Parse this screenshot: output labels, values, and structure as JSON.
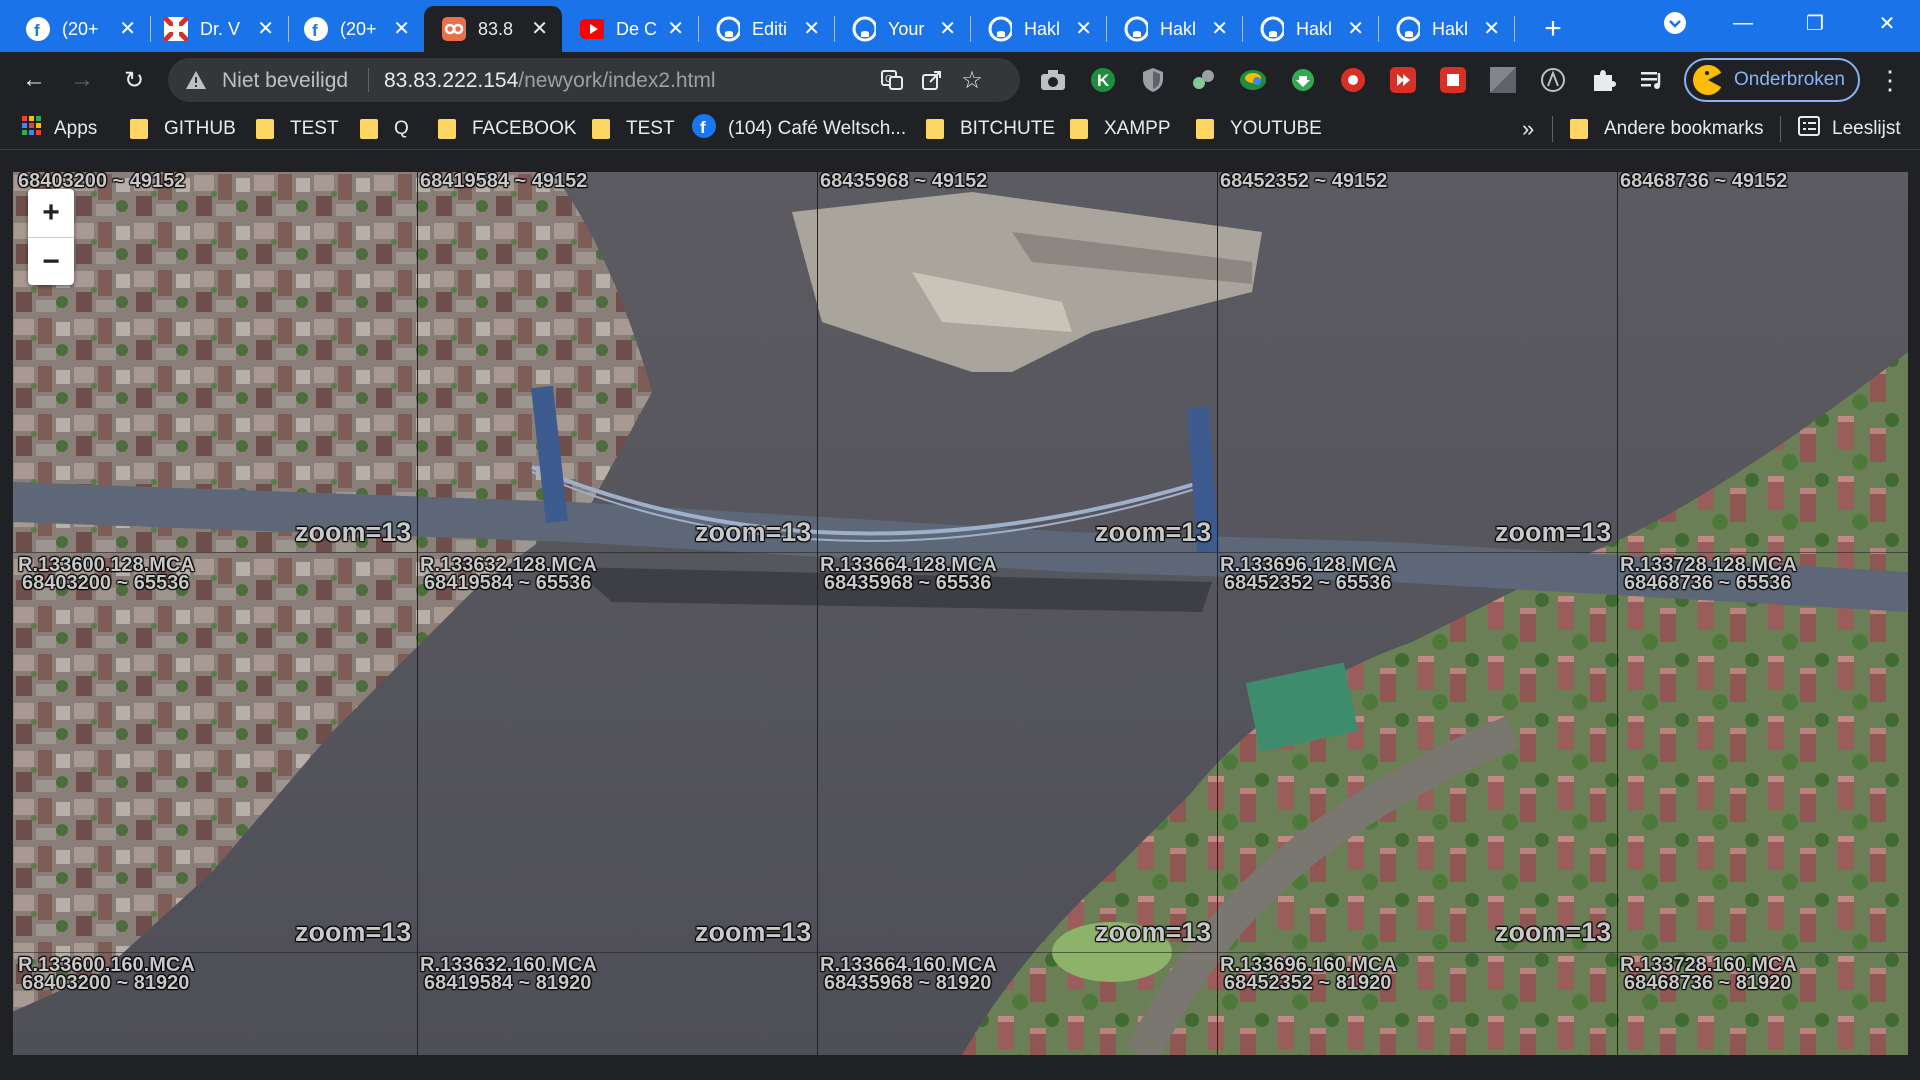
{
  "tabs": [
    {
      "title": "(20+",
      "icon": "facebook-icon"
    },
    {
      "title": "Dr. V",
      "icon": "flag-icon"
    },
    {
      "title": "(20+",
      "icon": "facebook-icon"
    },
    {
      "title": "83.8",
      "icon": "mca-icon",
      "active": true
    },
    {
      "title": "De C",
      "icon": "youtube-icon"
    },
    {
      "title": "Editi",
      "icon": "github-icon"
    },
    {
      "title": "Your",
      "icon": "github-icon"
    },
    {
      "title": "Hakl",
      "icon": "github-icon"
    },
    {
      "title": "Hakl",
      "icon": "github-icon"
    },
    {
      "title": "Hakl",
      "icon": "github-icon"
    },
    {
      "title": "Hakl",
      "icon": "github-icon"
    }
  ],
  "omnibox": {
    "security": "Niet beveiligd",
    "host": "83.83.222.154",
    "path": "/newyork/index2.html"
  },
  "profile": {
    "label": "Onderbroken"
  },
  "bookmarks": [
    {
      "label": "Apps",
      "icon": "apps-grid-icon"
    },
    {
      "label": "GITHUB",
      "icon": "folder-icon"
    },
    {
      "label": "TEST",
      "icon": "folder-icon"
    },
    {
      "label": "Q",
      "icon": "folder-icon"
    },
    {
      "label": "FACEBOOK",
      "icon": "folder-icon"
    },
    {
      "label": "TEST",
      "icon": "folder-icon"
    },
    {
      "label": "(104) Café Weltsch...",
      "icon": "facebook-icon"
    },
    {
      "label": "BITCHUTE",
      "icon": "folder-icon"
    },
    {
      "label": "XAMPP",
      "icon": "folder-icon"
    },
    {
      "label": "YOUTUBE",
      "icon": "folder-icon"
    }
  ],
  "bookmarks_more": "»",
  "other_bookmarks": "Andere bookmarks",
  "reading_list": "Leeslijst",
  "map": {
    "zoom_in": "+",
    "zoom_out": "−",
    "zoom_text": "zoom=13",
    "top_labels": [
      "68403200 ~ 49152",
      "68419584 ~ 49152",
      "68435968 ~ 49152",
      "68452352 ~ 49152",
      "68468736 ~ 49152"
    ],
    "row1_labels": [
      {
        "file": "R.133600.128.MCA",
        "coord": "68403200 ~ 65536"
      },
      {
        "file": "R.133632.128.MCA",
        "coord": "68419584 ~ 65536"
      },
      {
        "file": "R.133664.128.MCA",
        "coord": "68435968 ~ 65536"
      },
      {
        "file": "R.133696.128.MCA",
        "coord": "68452352 ~ 65536"
      },
      {
        "file": "R.133728.128.MCA",
        "coord": "68468736 ~ 65536"
      }
    ],
    "row2_labels": [
      {
        "file": "R.133600.160.MCA",
        "coord": "68403200 ~ 81920"
      },
      {
        "file": "R.133632.160.MCA",
        "coord": "68419584 ~ 81920"
      },
      {
        "file": "R.133664.160.MCA",
        "coord": "68435968 ~ 81920"
      },
      {
        "file": "R.133696.160.MCA",
        "coord": "68452352 ~ 81920"
      },
      {
        "file": "R.133728.160.MCA",
        "coord": "68468736 ~ 81920"
      }
    ]
  },
  "colors": {
    "tabstrip": "#1a73e8",
    "chrome_dark": "#202124",
    "water": "#55555e",
    "accent": "#8ab4f8"
  }
}
